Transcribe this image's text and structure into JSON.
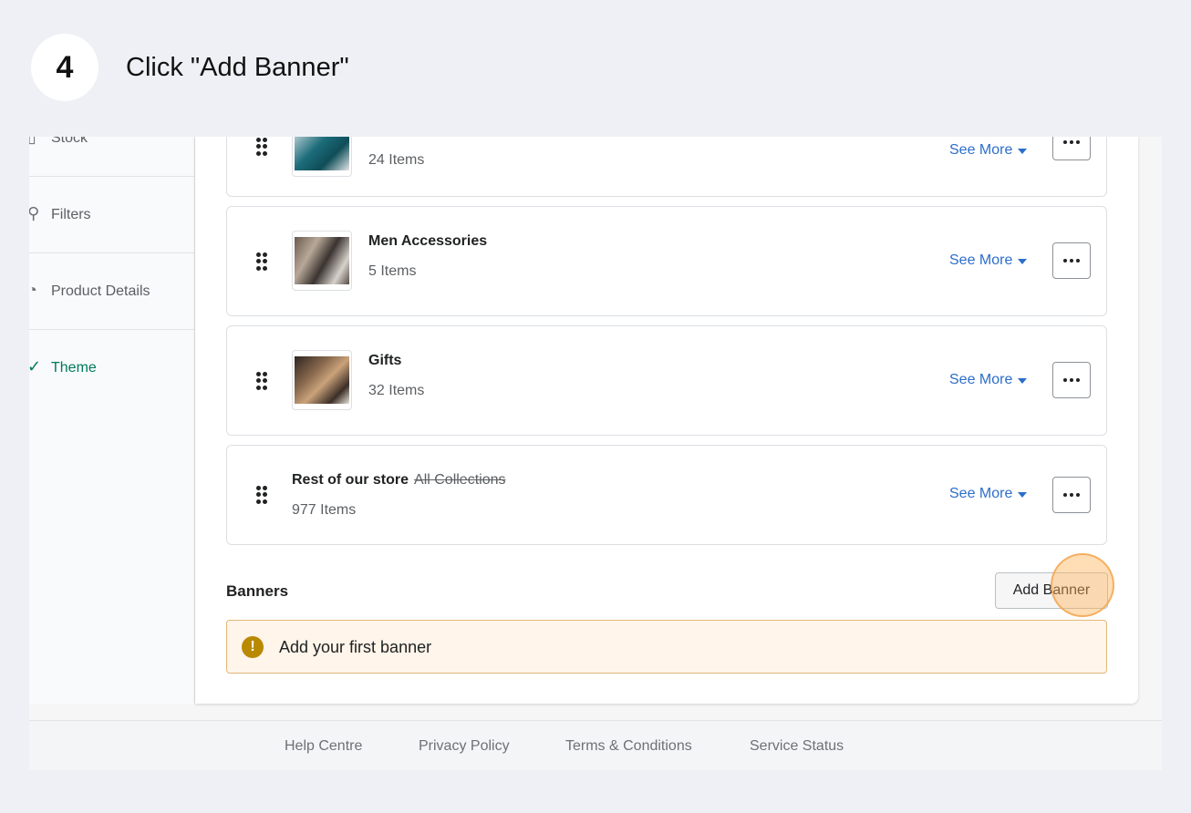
{
  "step": {
    "number": "4",
    "title": "Click \"Add Banner\""
  },
  "sidebar": {
    "items": [
      {
        "label": "Stock",
        "icon": "stock-icon"
      },
      {
        "label": "Filters",
        "icon": "filter-icon"
      },
      {
        "label": "Product Details",
        "icon": "tag-icon"
      },
      {
        "label": "Theme",
        "icon": "brush-icon",
        "active": true
      }
    ]
  },
  "collections": [
    {
      "title": "",
      "count": "24 Items"
    },
    {
      "title": "Men Accessories",
      "count": "5 Items"
    },
    {
      "title": "Gifts",
      "count": "32 Items"
    },
    {
      "title": "Rest of our store",
      "subtitle": "All Collections",
      "count": "977 Items"
    }
  ],
  "see_more_label": "See More",
  "banners": {
    "title": "Banners",
    "add_button": "Add Banner",
    "empty_notice": "Add your first banner"
  },
  "footer": {
    "links": [
      "Help Centre",
      "Privacy Policy",
      "Terms & Conditions",
      "Service Status"
    ]
  },
  "colors": {
    "accent": "#2c6ecb",
    "active_nav": "#007a5a",
    "notice_bg": "#fff5ea",
    "notice_icon": "#b98900",
    "highlight": "#f0a046"
  }
}
